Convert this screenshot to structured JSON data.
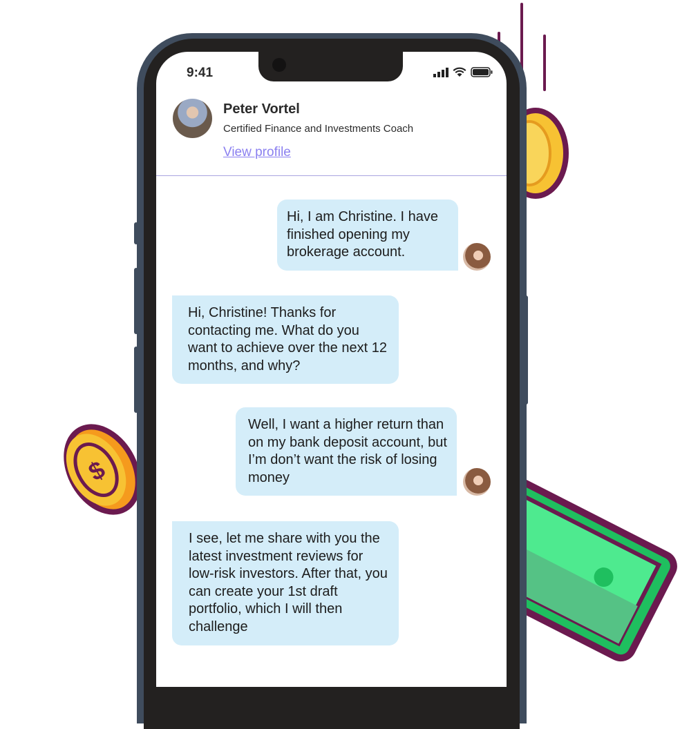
{
  "status_bar": {
    "time": "9:41",
    "icons": [
      "signal-icon",
      "wifi-icon",
      "battery-icon"
    ]
  },
  "contact": {
    "name": "Peter Vortel",
    "title": "Certified Finance and Investments Coach",
    "link": "View profile"
  },
  "messages": [
    {
      "from": "user",
      "text": "Hi, I am Christine. I have finished opening my brokerage account."
    },
    {
      "from": "coach",
      "text": "Hi, Christine! Thanks for contacting me. What do you want to achieve over the next 12 months, and why?"
    },
    {
      "from": "user",
      "text": "Well, I want a higher return than on my bank deposit account, but I’m don’t want the risk of losing money"
    },
    {
      "from": "coach",
      "text": "I see, let me share with you the latest investment reviews for low-risk investors. After that, you can create your 1st draft portfolio, which I will then challenge"
    }
  ],
  "colors": {
    "bubble": "#d4edf9",
    "link": "#8b80f0",
    "divider": "#a9a3e0",
    "coin": "#f7c233",
    "outline": "#6b1a4f",
    "bill": "#4eea8f"
  }
}
